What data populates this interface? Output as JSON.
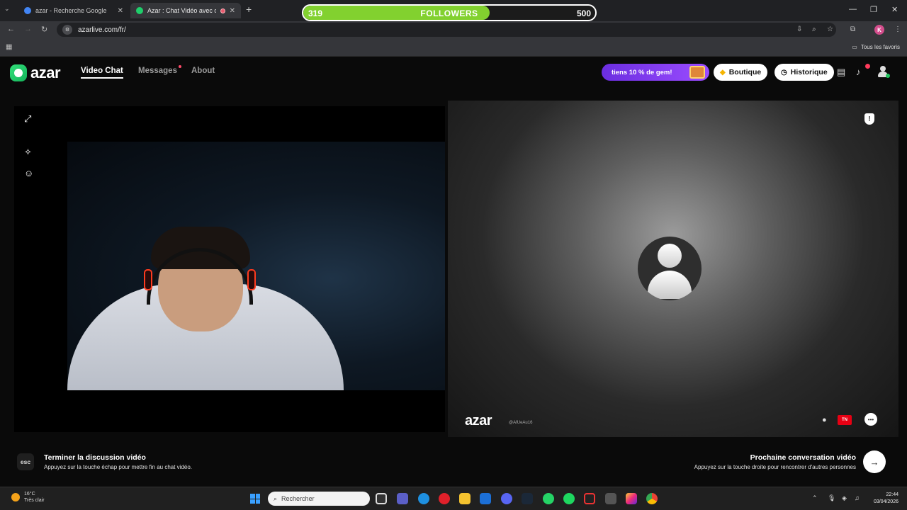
{
  "browser": {
    "tabs": [
      {
        "title": "azar - Recherche Google",
        "favicon_color": "#4285f4"
      },
      {
        "title": "Azar : Chat Vidéo avec de n",
        "favicon_color": "#1fcf6b"
      }
    ],
    "url": "azarlive.com/fr/",
    "bookmarks_label": "Tous les favoris",
    "profile_initial": "K"
  },
  "followers_overlay": {
    "current": "319",
    "label": "FOLLOWERS",
    "goal": "500",
    "progress": 0.638,
    "fill_color": "#82d12f"
  },
  "azar": {
    "logo_text": "azar",
    "nav": [
      {
        "label": "Video Chat",
        "active": true
      },
      {
        "label": "Messages",
        "active": false,
        "notification_dot": true
      },
      {
        "label": "About",
        "active": false
      }
    ],
    "promo_text": "tiens 10 % de gem!",
    "boutique_label": "Boutique",
    "historique_label": "Historique",
    "peer_logo_text": "azar",
    "peer_id": "@AfUeAu16",
    "peer_country": "TN",
    "esc_key": "esc",
    "end_title": "Terminer la discussion vidéo",
    "end_sub": "Appuyez sur la touche échap pour mettre fin au chat vidéo.",
    "next_title": "Prochaine conversation vidéo",
    "next_sub": "Appuyez sur la touche droite pour rencontrer d'autres personnes",
    "accent_green": "#1fcf6b",
    "promo_color": "#7b3cf0"
  },
  "taskbar": {
    "weather_temp": "16°C",
    "weather_desc": "Très clair",
    "search_placeholder": "Rechercher",
    "time": "22:44",
    "date": "03/04/2026"
  }
}
